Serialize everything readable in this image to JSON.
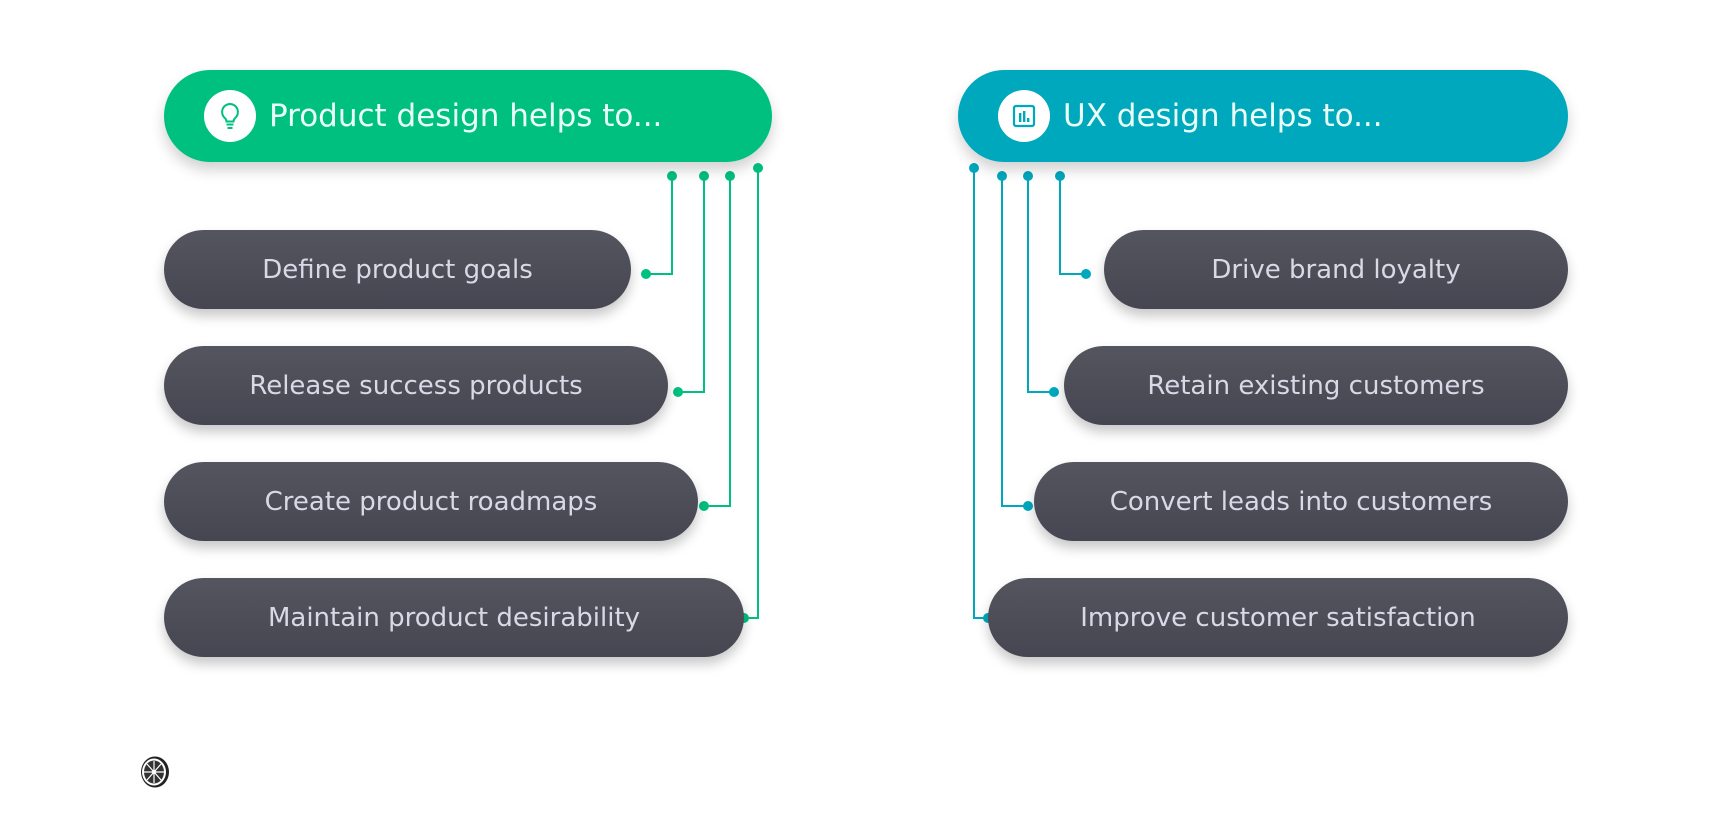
{
  "colors": {
    "product_accent": "#00c080",
    "ux_accent": "#00a8bd",
    "item_background": "#4c4c58",
    "item_text": "#d7d9e6"
  },
  "product": {
    "title": "Product design helps to...",
    "icon": "lightbulb-icon",
    "items": [
      {
        "label": "Define product goals"
      },
      {
        "label": "Release success products"
      },
      {
        "label": "Create product roadmaps"
      },
      {
        "label": "Maintain product desirability"
      }
    ]
  },
  "ux": {
    "title": "UX design helps to...",
    "icon": "bar-chart-icon",
    "items": [
      {
        "label": "Drive brand loyalty"
      },
      {
        "label": "Retain existing customers"
      },
      {
        "label": "Convert leads into customers"
      },
      {
        "label": "Improve customer satisfaction"
      }
    ]
  },
  "footer": {
    "logo_icon": "citrus-slice-logo-icon"
  }
}
